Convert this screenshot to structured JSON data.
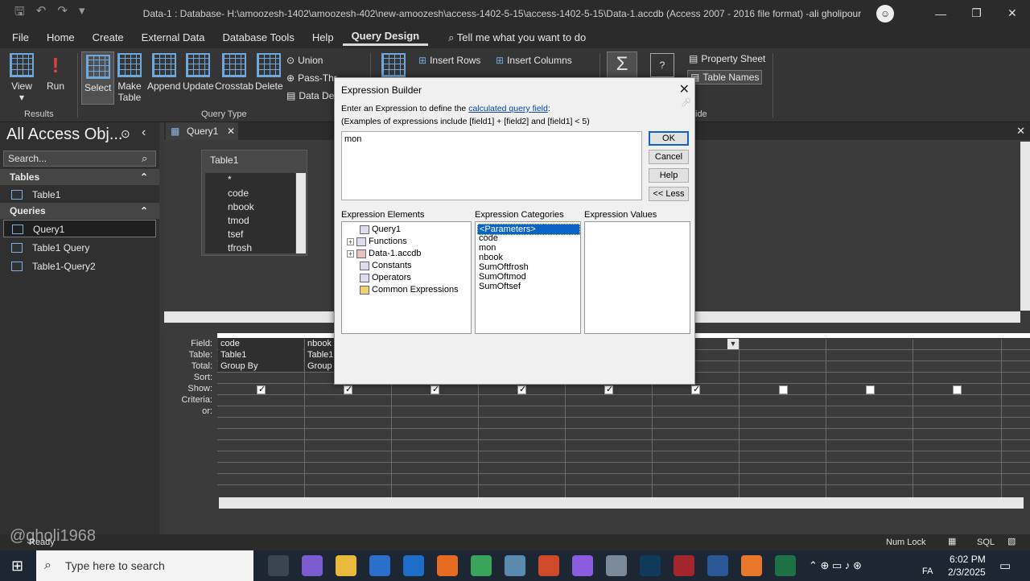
{
  "window": {
    "title": "Data-1 : Database- H:\\amoozesh-1402\\amoozesh-402\\new-amoozesh\\access-1402-5-15\\access-1402-5-15\\Data-1.accdb (Access 2007 - 2016 file format) - Access",
    "user": "ali gholipour"
  },
  "menu": {
    "items": [
      "File",
      "Home",
      "Create",
      "External Data",
      "Database Tools",
      "Help",
      "Query Design"
    ],
    "tell_me": "Tell me what you want to do"
  },
  "ribbon": {
    "view": "View",
    "run": "Run",
    "results_group": "Results",
    "select": "Select",
    "make_table": "Make Table",
    "append": "Append",
    "update": "Update",
    "crosstab": "Crosstab",
    "delete": "Delete",
    "union": "Union",
    "pass_through": "Pass-Thr",
    "data_def": "Data Def",
    "query_type_group": "Query Type",
    "insert_rows": "Insert Rows",
    "insert_columns": "Insert Columns",
    "property_sheet": "Property Sheet",
    "table_names": "Table Names",
    "ide": "ide"
  },
  "nav": {
    "title": "All Access Obj...",
    "search_placeholder": "Search...",
    "tables_header": "Tables",
    "queries_header": "Queries",
    "tables": [
      "Table1"
    ],
    "queries": [
      "Query1",
      "Table1 Query",
      "Table1-Query2"
    ]
  },
  "query_tab": "Query1",
  "table_box": {
    "name": "Table1",
    "fields": [
      "*",
      "code",
      "nbook",
      "tmod",
      "tsef",
      "tfrosh"
    ]
  },
  "grid": {
    "row_labels": [
      "Field:",
      "Table:",
      "Total:",
      "Sort:",
      "Show:",
      "Criteria:",
      "or:"
    ],
    "col1": {
      "field": "code",
      "table": "Table1",
      "total": "Group By"
    },
    "col2": {
      "field": "nbook",
      "table": "Table1",
      "total": "Group"
    },
    "show_checks": [
      true,
      true,
      true,
      true,
      true,
      true,
      false,
      false,
      false
    ]
  },
  "dialog": {
    "title": "Expression Builder",
    "desc_prefix": "Enter an Expression to define the ",
    "desc_link": "calculated query field",
    "desc_suffix": ":",
    "examples": "(Examples of expressions include [field1] + [field2] and [field1] < 5)",
    "expression": "mon",
    "ok": "OK",
    "cancel": "Cancel",
    "help": "Help",
    "less": "<< Less",
    "elements_label": "Expression Elements",
    "categories_label": "Expression Categories",
    "values_label": "Expression Values",
    "elements": [
      "Query1",
      "Functions",
      "Data-1.accdb",
      "Constants",
      "Operators",
      "Common Expressions"
    ],
    "categories": [
      "<Parameters>",
      "code",
      "mon",
      "nbook",
      "SumOftfrosh",
      "SumOftmod",
      "SumOftsef"
    ]
  },
  "status": {
    "num_lock": "Num Lock",
    "sql": "SQL",
    "ready": "Ready"
  },
  "taskbar": {
    "search_placeholder": "Type here to search",
    "time": "6:02 PM",
    "date": "2/3/2025",
    "lang": "FA"
  },
  "watermark": "@gholi1968"
}
